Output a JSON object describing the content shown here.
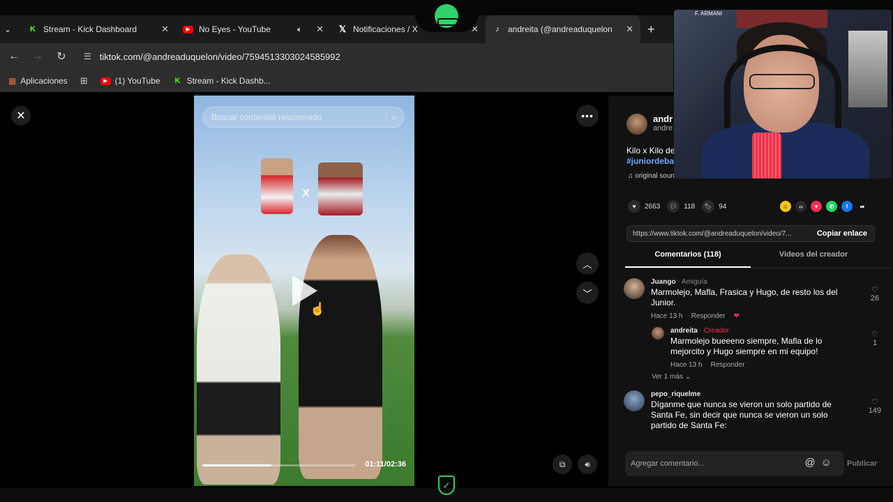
{
  "tabs": [
    {
      "label": "Stream - Kick Dashboard",
      "icon": "kick-icon",
      "active": false
    },
    {
      "label": "No Eyes - YouTube",
      "icon": "youtube-icon",
      "active": false,
      "audio": true
    },
    {
      "label": "Notificaciones / X",
      "icon": "x-icon",
      "active": false
    },
    {
      "label": "andreita (@andreaduquelon) | T",
      "icon": "tiktok-icon",
      "active": true
    }
  ],
  "address": {
    "url": "tiktok.com/@andreaduquelon/video/7594513303024585992"
  },
  "bookmarks": [
    {
      "label": "Aplicaciones"
    },
    {
      "label": "(1) YouTube"
    },
    {
      "label": "Stream - Kick Dashb..."
    }
  ],
  "video": {
    "search_placeholder": "Buscar contenido relacionado",
    "time": "01:11/02:36",
    "progress": 0.45,
    "overlay_text": "X"
  },
  "post": {
    "author_name": "andr",
    "author_handle": "andre",
    "desc_line1": "Kilo x Kilo de",
    "hashtag": "#juniordeba",
    "sound": "original sound - andreita",
    "likes": "2663",
    "comments_count": "118",
    "saves": "94",
    "link": "https://www.tiktok.com/@andreaduquelon/video/7...",
    "copy_label": "Copiar enlace",
    "tab_comments": "Comentarios (118)",
    "tab_creator": "Videos del creador"
  },
  "comments": [
    {
      "user": "Juango",
      "role": " · Amigo/a",
      "text": "Marmolejo, Mafla, Frasica y Hugo, de resto los del Junior.",
      "time": "Hace 13 h",
      "reply_label": "Responder",
      "likes": "26"
    },
    {
      "user": "andreita",
      "role": " · Creador",
      "text": "Marmolejo bueeeno siempre, Mafla de lo mejorcito y Hugo siempre en mi equipo!",
      "time": "Hace 13 h",
      "reply_label": "Responder",
      "likes": "1"
    },
    {
      "user": "pepo_riquelme",
      "role": "",
      "text": "Díganme que nunca se vieron un solo partido de Santa Fe, sin decir que nunca se vieron un solo partido de Santa Fe:",
      "likes": "149"
    }
  ],
  "more_replies": "Ver 1 más",
  "compose": {
    "placeholder": "Agregar comentario...",
    "publish": "Publicar"
  },
  "webcam": {
    "label": "F. ARMANI"
  },
  "colors": {
    "accent": "#fe2c55",
    "kick": "#53fc18",
    "overlay_green": "#2fd36a"
  }
}
